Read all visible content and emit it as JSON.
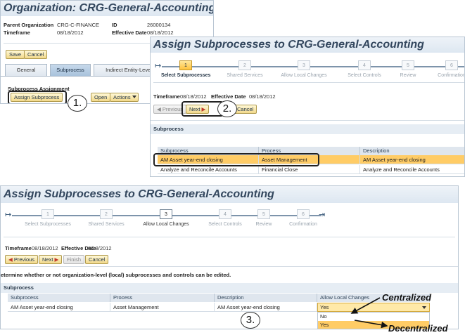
{
  "panel1": {
    "title": "Organization: CRG-General-Accounting",
    "fields": {
      "parent_org_label": "Parent Organization",
      "parent_org_value": "CRG-C-FINANCE",
      "id_label": "ID",
      "id_value": "26000134",
      "timeframe_label": "Timeframe",
      "timeframe_value": "08/18/2012",
      "effective_date_label": "Effective Date",
      "effective_date_value": "08/18/2012"
    },
    "save_label": "Save",
    "cancel_label": "Cancel",
    "tabs": [
      "General",
      "Subprocess",
      "Indirect Entity-Level"
    ],
    "section_title": "Subprocess Assignment",
    "buttons": {
      "assign": "Assign Subprocess",
      "open": "Open",
      "actions": "Actions"
    }
  },
  "wizard": {
    "title": "Assign Subprocesses to CRG-General-Accounting",
    "steps": [
      {
        "num": "1",
        "label": "Select Subprocesses"
      },
      {
        "num": "2",
        "label": "Shared Services"
      },
      {
        "num": "3",
        "label": "Allow Local Changes"
      },
      {
        "num": "4",
        "label": "Select Controls"
      },
      {
        "num": "5",
        "label": "Review"
      },
      {
        "num": "6",
        "label": "Confirmation"
      }
    ],
    "timeframe_label": "Timeframe",
    "timeframe_value": "08/18/2012",
    "effective_label": "Effective Date",
    "effective_value": "08/18/2012",
    "previous_label": "Previous",
    "next_label": "Next",
    "finish_label": "Finish",
    "cancel_label": "Cancel"
  },
  "panel2": {
    "section_title": "Subprocess",
    "columns": [
      "Subprocess",
      "Process",
      "Description"
    ],
    "rows": [
      {
        "subprocess": "AM Asset year-end closing",
        "process": "Asset Management",
        "description": "AM Asset year-end closing"
      },
      {
        "subprocess": "Analyze and Reconcile Accounts",
        "process": "Financial Close",
        "description": "Analyze and Reconcile Accounts"
      }
    ]
  },
  "panel3": {
    "instruction": "etermine whether or not organization-level (local) subprocesses and controls can be edited.",
    "section_title": "Subprocess",
    "columns": [
      "Subprocess",
      "Process",
      "Description",
      "Allow Local Changes"
    ],
    "row": {
      "subprocess": "AM Asset year-end closing",
      "process": "Asset Management",
      "description": "AM Asset year-end closing",
      "allow_local_changes": "Yes"
    },
    "dropdown_options": [
      "No",
      "Yes"
    ]
  },
  "annotations": {
    "c1": "1.",
    "c2": "2.",
    "c3": "3.",
    "centralized": "Centralized",
    "decentralized": "Decentralized"
  }
}
